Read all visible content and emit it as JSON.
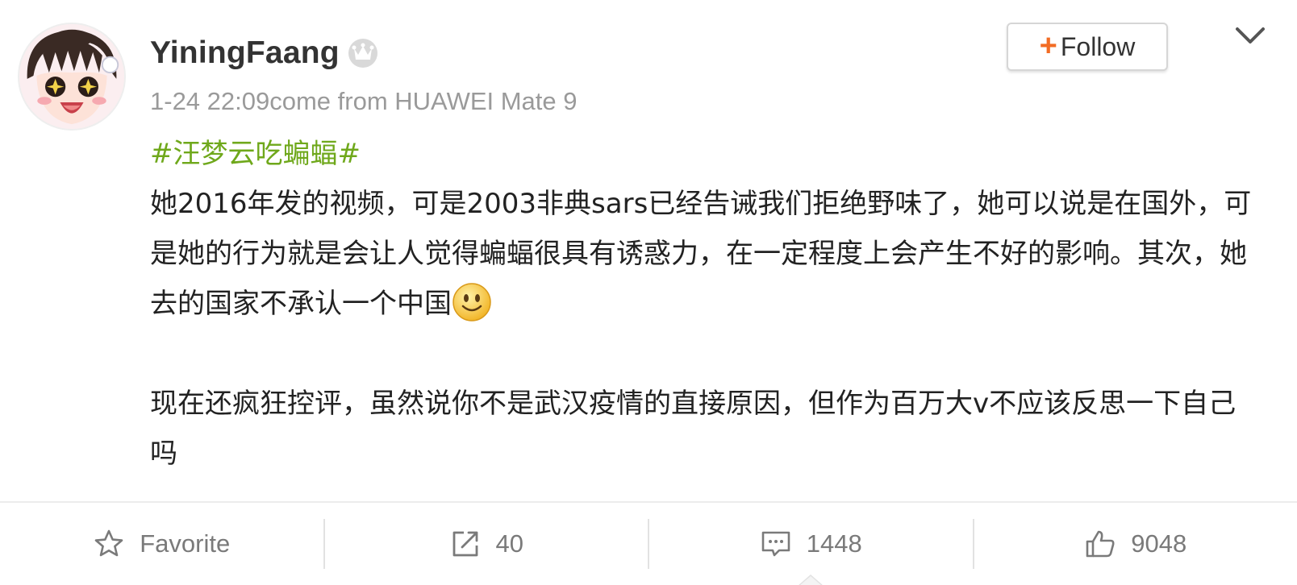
{
  "post": {
    "username": "YiningFaang",
    "timestamp": "1-24 22:09",
    "source": "come from HUAWEI Mate 9",
    "follow_label": "Follow",
    "hashtag": "#汪梦云吃蝙蝠#",
    "paragraph_1": "她2016年发的视频，可是2003非典sars已经告诫我们拒绝野味了，她可以说是在国外，可是她的行为就是会让人觉得蝙蝠很具有诱惑力，在一定程度上会产生不好的影响。其次，她去的国家不承认一个中国",
    "paragraph_2": "现在还疯狂控评，虽然说你不是武汉疫情的直接原因，但作为百万大v不应该反思一下自己吗"
  },
  "icons": {
    "verified": "crown-icon",
    "follow": "plus-icon",
    "menu": "chevron-down-icon",
    "emoji": "smiley-icon"
  },
  "actions": {
    "favorite": {
      "icon": "star-icon",
      "label": "Favorite"
    },
    "repost": {
      "icon": "share-icon",
      "count": "40"
    },
    "comment": {
      "icon": "comment-icon",
      "count": "1448"
    },
    "like": {
      "icon": "thumbs-up-icon",
      "count": "9048"
    }
  },
  "colors": {
    "hashtag": "#6fa81b",
    "follow_plus": "#f26c24",
    "meta_text": "#9a9a9a"
  }
}
